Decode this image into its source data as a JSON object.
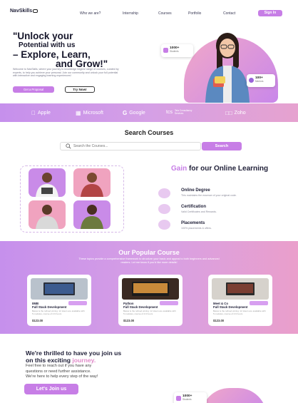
{
  "brand": {
    "logo": "NavSkills"
  },
  "nav": {
    "links": [
      "Who we are?",
      "Internship",
      "Courses",
      "Portfolio",
      "Contact"
    ],
    "signin_label": "Sign In"
  },
  "hero": {
    "title_line1": "\"Unlock your",
    "title_line2": "Potential with us",
    "title_line3": "– Explore, Learn,",
    "title_line4": "and Grow!\"",
    "description": "Welcome to NavSkills, where your journey to knowledge begins! range of courses, curated by experts, to help you achieve your personal. Join our community and unlock your full potential with interactive and engaging learning experiences!",
    "primary_button": "Get a Proposal",
    "secondary_button": "Try Now!",
    "badge_students_value": "1000+",
    "badge_students_label": "Students",
    "badge_mentors_value": "100+",
    "badge_mentors_label": "Mentors"
  },
  "partners": [
    {
      "name": "Apple",
      "icon": "apple-icon"
    },
    {
      "name": "Microsoft",
      "icon": "microsoft-icon"
    },
    {
      "name": "Google",
      "icon": "google-icon"
    },
    {
      "name": "Tata Consultancy Services",
      "icon": "tcs-icon"
    },
    {
      "name": "Zoho",
      "icon": "zoho-icon"
    }
  ],
  "search": {
    "title": "Search Courses",
    "placeholder": "Search the Courses...",
    "button": "Search"
  },
  "gain": {
    "title_highlight": "Gain",
    "title_rest": "for our Online Learning",
    "features": [
      {
        "title": "Online Degree",
        "desc": "This maintains the essence of your original code."
      },
      {
        "title": "Certification",
        "desc": "Valid Certificates and Rewards."
      },
      {
        "title": "Placements",
        "desc": "100% placements & offers."
      }
    ]
  },
  "popular": {
    "title": "Our Popular Course",
    "subtitle": "These topics provide a comprehensive framework to structure your basic and appeal to both beginners and advanced readers. Let me know if you'd like more details!",
    "courses": [
      {
        "tag": "New",
        "title_line1": "IIMB",
        "title_line2": "Full Stack Development",
        "meta": "Below is the refined pricing: 12 Hours are available with 5 modules, course of 4.6 hours",
        "price": "$123.00"
      },
      {
        "tag": "New",
        "title_line1": "Python",
        "title_line2": "Full Stack Development",
        "meta": "Below is the refined pricing: 12 Hours are available with 5 modules, course of 4.6 hours",
        "price": "$123.00"
      },
      {
        "tag": "New",
        "title_line1": "Meet & Co",
        "title_line2": "Full Stack Development",
        "meta": "Below is the refined pricing: 12 Hours are available with 5 modules, course of 4.6 hours",
        "price": "$123.00"
      }
    ]
  },
  "join": {
    "title_line1": "We're thrilled to have you join us",
    "title_line2_pre": "on this exciting",
    "title_line2_hl": "journey.",
    "desc_line1": "Feel free to reach out if you have any",
    "desc_line2": "questions or need further assistance.",
    "desc_line3": "We're here to help every step of the way!",
    "button": "Let's Join us",
    "badge_value": "1000+",
    "badge_label": "Students"
  },
  "colors": {
    "accent": "#c77ee6",
    "accent_pink": "#e08ac8",
    "text_dark": "#22223a"
  }
}
